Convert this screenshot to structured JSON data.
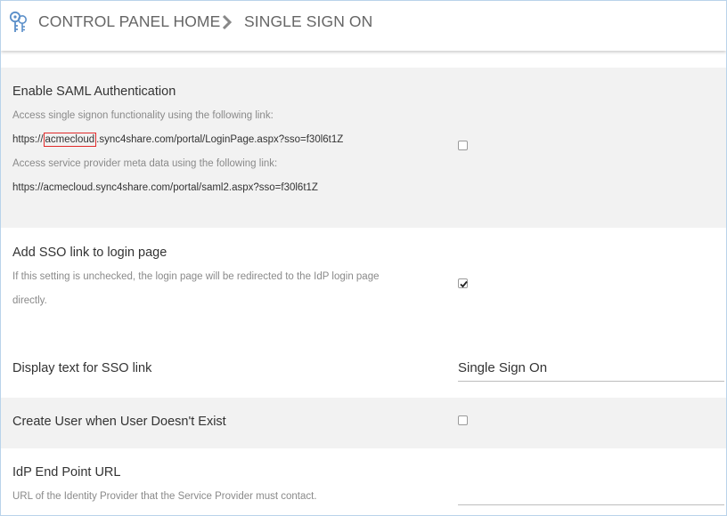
{
  "header": {
    "home_label": "CONTROL PANEL HOME",
    "current_label": "SINGLE SIGN ON"
  },
  "saml": {
    "title": "Enable SAML Authentication",
    "sso_hint": "Access single signon functionality using the following link:",
    "sso_url_prefix": "https://",
    "sso_url_highlight": "acmecloud",
    "sso_url_suffix": ".sync4share.com/portal/LoginPage.aspx?sso=f30l6t1Z",
    "meta_hint": "Access service provider meta data using the following link:",
    "meta_url": "https://acmecloud.sync4share.com/portal/saml2.aspx?sso=f30l6t1Z",
    "checked": false
  },
  "sso_link": {
    "title": "Add SSO link to login page",
    "hint_line1": "If this setting is unchecked, the login page will be redirected to the IdP login page",
    "hint_line2": "directly.",
    "checked": true
  },
  "display_text": {
    "title": "Display text for SSO link",
    "value": "Single Sign On"
  },
  "create_user": {
    "title": "Create User when User Doesn't Exist",
    "checked": false
  },
  "idp": {
    "title": "IdP End Point URL",
    "hint": "URL of the Identity Provider that the Service Provider must contact.",
    "value": ""
  },
  "colors": {
    "highlight_border": "#e02b2b",
    "grey_row": "#f2f2f2",
    "frame_border": "#b9d3ea",
    "logo": "#5b8fc9"
  }
}
